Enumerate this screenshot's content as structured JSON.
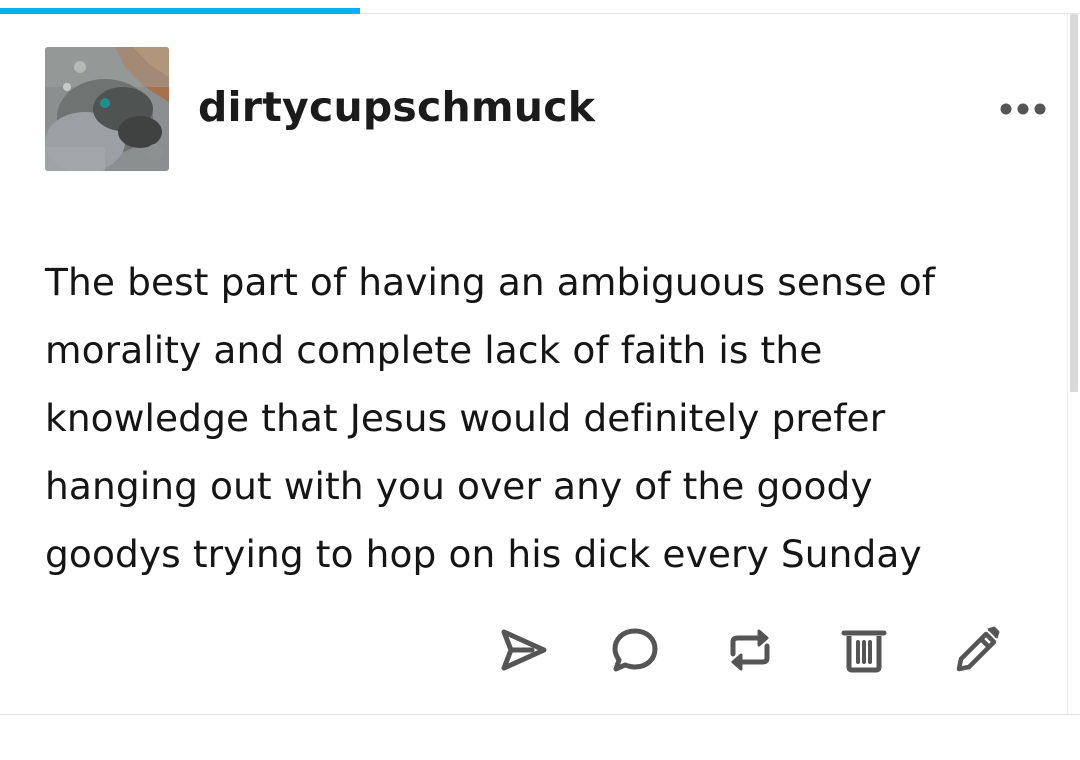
{
  "progress": {
    "percent": 33.3,
    "color": "#00b3ef"
  },
  "post": {
    "username": "dirtycupschmuck",
    "body": "The best part of having an ambiguous sense of morality and complete lack of faith is the knowledge that Jesus would definitely prefer hanging out with you over any of the goody goodys trying to hop on his dick every Sunday"
  },
  "menu": {
    "icon": "more-horizontal-icon"
  },
  "actions": [
    {
      "icon": "share-send-icon"
    },
    {
      "icon": "comment-icon"
    },
    {
      "icon": "reblog-icon"
    },
    {
      "icon": "delete-trash-icon"
    },
    {
      "icon": "edit-pencil-icon"
    }
  ],
  "colors": {
    "icon": "#555555",
    "text": "#151515",
    "accent": "#00b3ef"
  }
}
